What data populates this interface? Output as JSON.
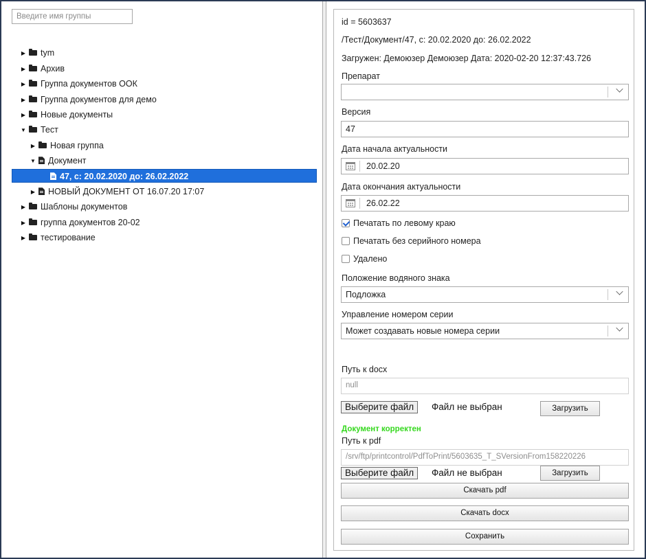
{
  "search": {
    "placeholder": "Введите имя группы"
  },
  "tree": {
    "items": [
      {
        "label": "tym"
      },
      {
        "label": "Архив"
      },
      {
        "label": "Группа документов ООК"
      },
      {
        "label": "Группа документов для демо"
      },
      {
        "label": "Новые документы"
      },
      {
        "label": "Тест"
      },
      {
        "label": "Новая группа"
      },
      {
        "label": "Документ"
      },
      {
        "label": "47, с: 20.02.2020 до: 26.02.2022"
      },
      {
        "label": "НОВЫЙ ДОКУМЕНТ ОТ 16.07.20 17:07"
      },
      {
        "label": "Шаблоны документов"
      },
      {
        "label": "группа документов 20-02"
      },
      {
        "label": "тестирование"
      }
    ],
    "selected": "47, с: 20.02.2020 до: 26.02.2022"
  },
  "details": {
    "id_line": "id = 5603637",
    "path_line": "/Тест/Документ/47, с: 20.02.2020 до: 26.02.2022",
    "loaded_line": "Загружен: Демоюзер Демоюзер Дата: 2020-02-20 12:37:43.726",
    "preparat": {
      "label": "Препарат",
      "value": ""
    },
    "version": {
      "label": "Версия",
      "value": "47"
    },
    "start_date": {
      "label": "Дата начала актуальности",
      "value": "20.02.20"
    },
    "end_date": {
      "label": "Дата окончания актуальности",
      "value": "26.02.22"
    },
    "checkboxes": [
      {
        "label": "Печатать по левому краю",
        "checked": true
      },
      {
        "label": "Печатать без серийного номера",
        "checked": false
      },
      {
        "label": "Удалено",
        "checked": false
      }
    ],
    "watermark": {
      "label": "Положение водяного знака",
      "value": "Подложка"
    },
    "serial": {
      "label": "Управление номером серии",
      "value": "Может создавать новые номера серии"
    },
    "docx": {
      "label": "Путь к docx",
      "value": "null",
      "choose_label": "Выберите файл",
      "no_file": "Файл не выбран",
      "upload_label": "Загрузить"
    },
    "status_ok": "Документ корректен",
    "pdf": {
      "label": "Путь к pdf",
      "value": "/srv/ftp/printcontrol/PdfToPrint/5603635_T_SVersionFrom158220226",
      "choose_label": "Выберите файл",
      "no_file": "Файл не выбран",
      "upload_label": "Загрузить"
    },
    "download_pdf": "Скачать pdf",
    "download_docx": "Скачать docx",
    "save": "Сохранить"
  },
  "colors": {
    "selection": "#1f6fdc",
    "status_ok": "#35d81e",
    "frame": "#2b3a55"
  }
}
